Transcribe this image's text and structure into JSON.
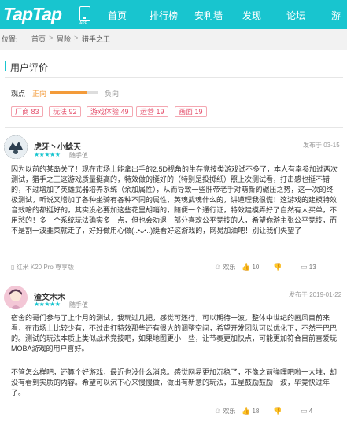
{
  "header": {
    "logo": "TapTap",
    "app_label": "APP",
    "nav": [
      "首页",
      "排行榜",
      "安利墙",
      "发现",
      "论坛",
      "游"
    ]
  },
  "breadcrumb": {
    "prefix": "位置:",
    "items": [
      "首页",
      "冒险",
      "猎手之王"
    ],
    "separator": ">"
  },
  "reviews_section": {
    "title": "用户评价",
    "view_label": "观点",
    "positive_label": "正向",
    "negative_label": "负向",
    "positive_ratio": 0.78,
    "tags": [
      {
        "name": "厂商",
        "count": "83"
      },
      {
        "name": "玩法",
        "count": "92"
      },
      {
        "name": "游戏体验",
        "count": "49"
      },
      {
        "name": "运营",
        "count": "19"
      },
      {
        "name": "画面",
        "count": "19"
      }
    ]
  },
  "reviews": [
    {
      "user": "虎牙丶小鲶天",
      "stars": "★★★★★",
      "play_label": "随手值",
      "date": "发布于 03-15",
      "text": "因为以前的某岛关了！现在市场上能拿出手的2.5D视角的生存竞技类游戏试不多了，本人有幸参加过两次测试，猎手之王这游戏质量挺高的，特效做的挺好的（特别是投掷纸）照上次测试看，打击感也挺不错的，不过增加了英雄武器培养系统（余加属性），从而导致一些肝帝老手对萌新的碾压之势，这一次的终极测试，听说又增加了各种坐骑有各种不同的属性，英魂武魂什么的，讲道理我很慌！这游戏的建模特效音效啥的都挺好的，其实没必要加这些花里胡哨的，随便一个通行证，特效建模弄好了自然有人买单，不用愁的！多一个系统玩法确实多一点，但也会劝退一部分喜欢公平竞技的人，希望你游主张公平竞技，而不是割一波韭菜就走了，好好做用心做(..•ᴗ•..)挺看好这游戏的，网易加油吧！别让我们失望了",
      "device": "红米 K20 Pro 尊享版",
      "actions": {
        "like_label": "欢乐",
        "up": "10",
        "down": "",
        "reply": "13"
      }
    },
    {
      "user": "渣文木木",
      "stars": "★★★★★",
      "play_label": "随手值",
      "date": "发布于 2019-01-22",
      "text": "宿舍的哥们参与了上个月的测试，我玩过几把，感觉可还行，可以期待一波。整体中世纪的画风目前来看，在市场上比较少有，不过击打特效那些还有很大的调整空间，希望开发团队可以优化下，不然干巴巴的。测试的玩法本质上类似战术竞技吧，如果地图更小一些，让节奏更加快点，可能更加符合目前喜爱玩MOBA游戏的用户喜好。",
      "text2": "不管怎么样吧，还算个好游戏，最近也没什么消息。感觉网易更加沉稳了，不像之前弹哩吧啦一大堆，却没有看到实质的内容。希望可以沉下心来慢慢做，做出有新意的玩法，五星鼓励鼓励一波，毕竟快过年了。",
      "actions": {
        "like_label": "欢乐",
        "up": "18",
        "down": "",
        "reply": "4"
      }
    }
  ]
}
